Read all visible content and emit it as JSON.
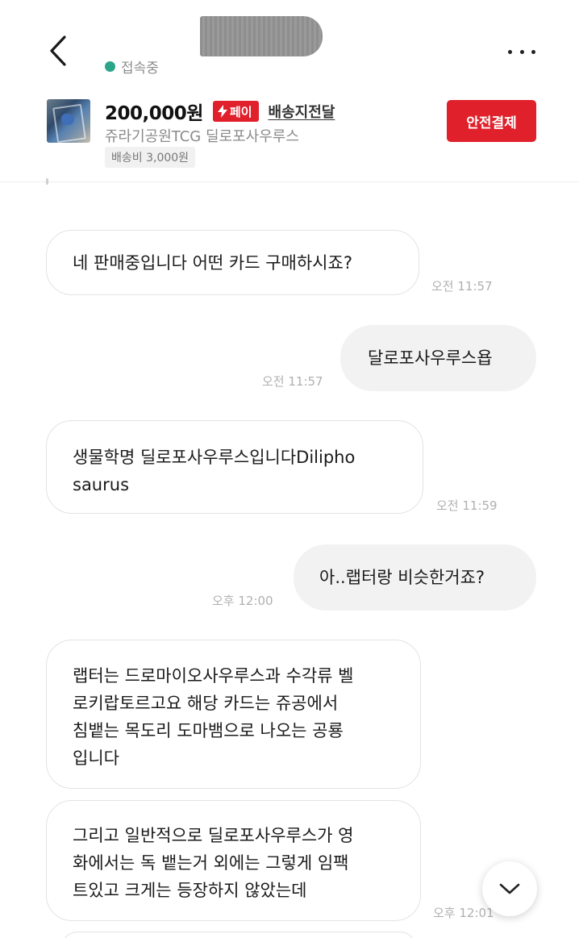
{
  "header": {
    "back_icon": "chevron-left-icon",
    "status_text": "접속중",
    "status_color": "#2aa58a",
    "more_icon": "more-horizontal-icon"
  },
  "product": {
    "price": "200,000원",
    "pay_badge": "페이",
    "delivery_link": "배송지전달",
    "name": "쥬라기공원TCG 딜로포사우루스",
    "shipping_fee": "배송비 3,000원",
    "safe_pay_button": "안전결제",
    "accent_color": "#e0202b"
  },
  "messages": [
    {
      "side": "in",
      "text": "네 판매중입니다 어떤 카드 구매하시죠?",
      "time": "오전 11:57"
    },
    {
      "side": "out",
      "text": "달로포사우루스욥",
      "time": "오전 11:57"
    },
    {
      "side": "in",
      "lines": [
        "생물학명 딜로포사우루스입니다Dilipho",
        "saurus"
      ],
      "time": "오전 11:59"
    },
    {
      "side": "out",
      "text": "아..랩터랑 비슷한거죠?",
      "time": "오후 12:00"
    },
    {
      "side": "in",
      "lines": [
        "랩터는 드로마이오사우루스과 수각류 벨",
        "로키랍토르고요 해당 카드는 쥬공에서",
        "침뱉는 목도리 도마뱀으로 나오는 공룡",
        "입니다"
      ]
    },
    {
      "side": "in",
      "lines": [
        "그리고 일반적으로 딜로포사우루스가 영",
        "화에서는 독 뱉는거 외에는 그렇게 임팩",
        "트있고 크게는 등장하지 않았는데"
      ],
      "time": "오후 12:01"
    }
  ],
  "scroll_button_icon": "chevron-down-icon"
}
